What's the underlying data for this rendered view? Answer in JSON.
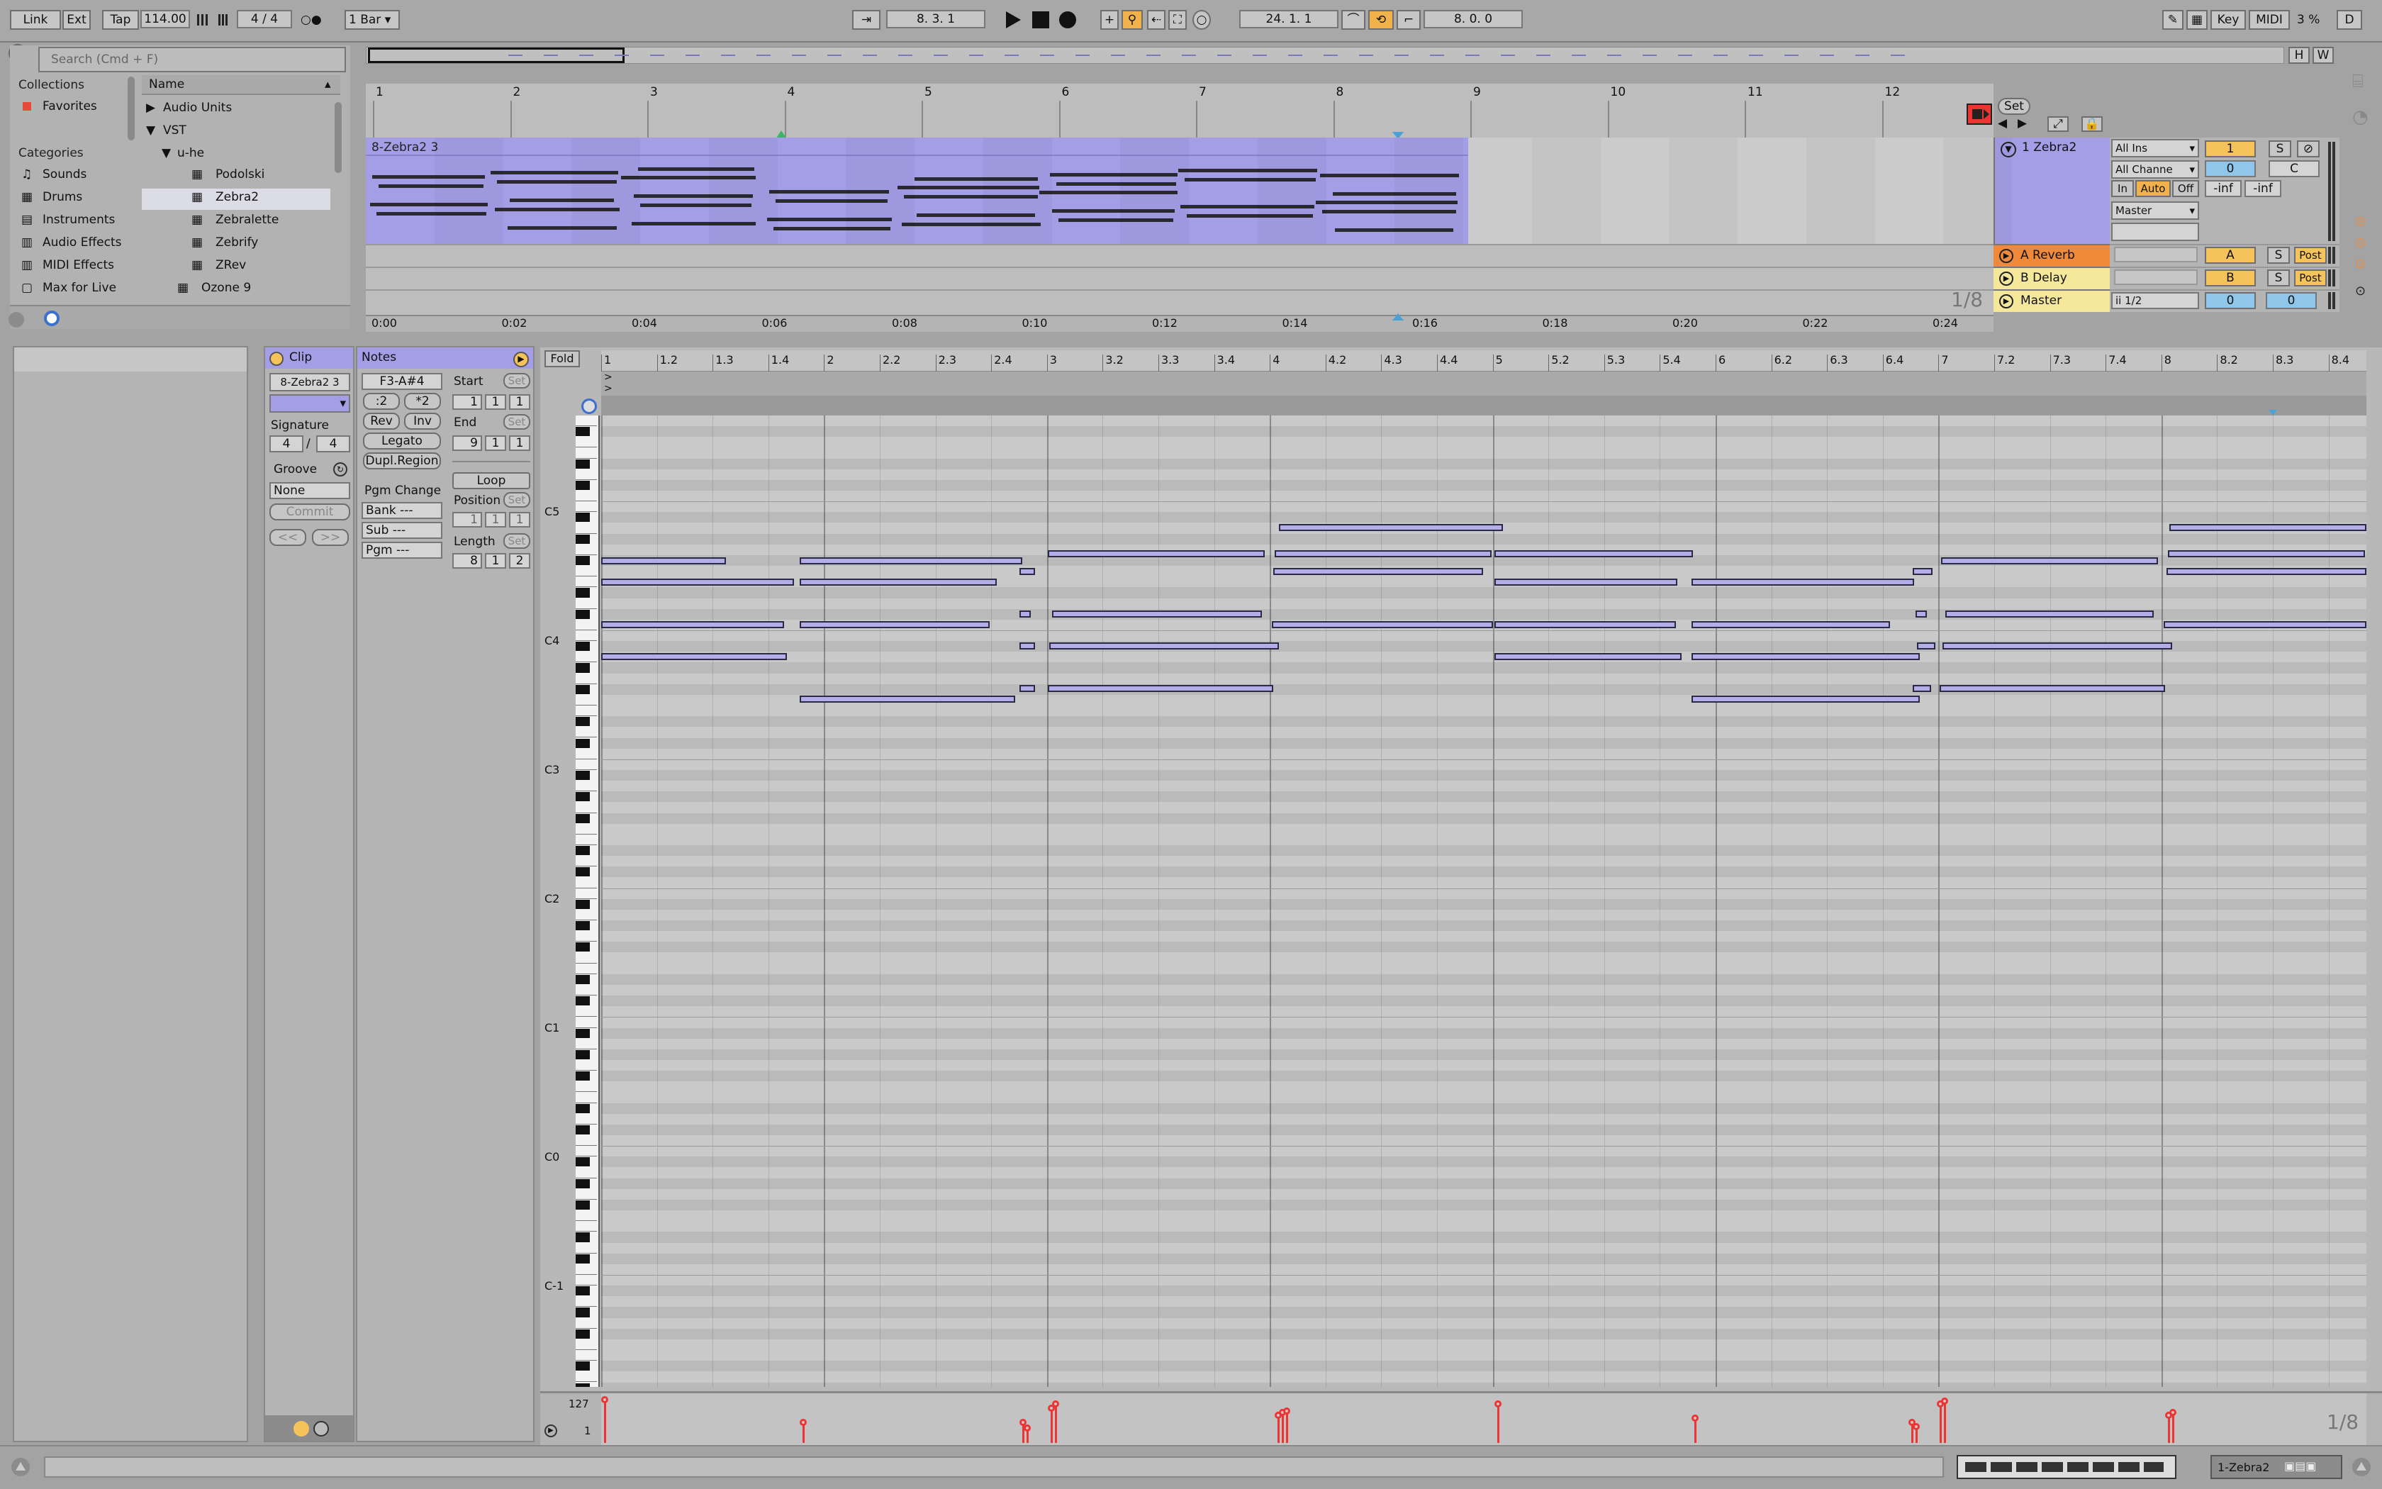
{
  "transport": {
    "link": "Link",
    "ext": "Ext",
    "tap": "Tap",
    "tempo": "114.00",
    "signature": "4 / 4",
    "metronome": "○●",
    "quantize": "1 Bar",
    "arrangement_position": "8.   3.   1",
    "loop_start": "24.   1.   1",
    "loop_length": "8.   0.   0",
    "key": "Key",
    "midi": "MIDI",
    "cpu": "3 %",
    "disk": "D"
  },
  "browser": {
    "search_placeholder": "Search (Cmd + F)",
    "collections_heading": "Collections",
    "favorites": "Favorites",
    "categories_heading": "Categories",
    "categories": [
      "Sounds",
      "Drums",
      "Instruments",
      "Audio Effects",
      "MIDI Effects",
      "Max for Live"
    ],
    "column_name": "Name",
    "tree": [
      "Audio Units",
      "VST",
      "u-he",
      "Podolski",
      "Zebra2",
      "Zebralette",
      "Zebrify",
      "ZRev",
      "Ozone 9"
    ]
  },
  "arrangement": {
    "bar_numbers": [
      "1",
      "2",
      "3",
      "4",
      "5",
      "6",
      "7",
      "8",
      "9",
      "10",
      "11",
      "12"
    ],
    "time_labels": [
      "0:00",
      "0:02",
      "0:04",
      "0:06",
      "0:08",
      "0:10",
      "0:12",
      "0:14",
      "0:16",
      "0:18",
      "0:20",
      "0:22",
      "0:24"
    ],
    "clip_name": "8-Zebra2 3",
    "grid": "1/8",
    "set_button": "Set",
    "view_h": "H",
    "view_w": "W"
  },
  "mixer": {
    "track_name": "1 Zebra2",
    "input_type": "All Ins",
    "input_channel": "All Channe",
    "monitor_in": "In",
    "monitor_auto": "Auto",
    "monitor_off": "Off",
    "output": "Master",
    "track_number": "1",
    "solo": "S",
    "volume": "0",
    "pan": "C",
    "peak_l": "-inf",
    "peak_r": "-inf",
    "returns": [
      {
        "name": "A Reverb",
        "letter": "A",
        "solo": "S",
        "post": "Post",
        "color": "#f08a3a"
      },
      {
        "name": "B Delay",
        "letter": "B",
        "solo": "S",
        "post": "Post",
        "color": "#f6e89a"
      },
      {
        "name": "Master",
        "letter": "0",
        "solo": "",
        "post": "",
        "color": "#f6e89a"
      }
    ],
    "master_cue": "ii 1/2",
    "master_vol": "0"
  },
  "clip_view": {
    "clip_title": "Clip",
    "clip_name": "8-Zebra2 3",
    "signature_label": "Signature",
    "sig_num": "4",
    "sig_den": "4",
    "groove_label": "Groove",
    "groove_value": "None",
    "commit": "Commit",
    "nav_prev": "<<",
    "nav_next": ">>",
    "notes_title": "Notes",
    "note_range": "F3-A#4",
    "half": ":2",
    "double": "*2",
    "rev": "Rev",
    "inv": "Inv",
    "legato": "Legato",
    "dupl": "Dupl.Region",
    "pgm_change": "Pgm Change",
    "bank": "Bank ---",
    "sub": "Sub ---",
    "pgm": "Pgm ---",
    "start_label": "Start",
    "start": [
      "1",
      "1",
      "1"
    ],
    "end_label": "End",
    "end": [
      "9",
      "1",
      "1"
    ],
    "loop": "Loop",
    "position_label": "Position",
    "position": [
      "1",
      "1",
      "1"
    ],
    "length_label": "Length",
    "length": [
      "8",
      "1",
      "2"
    ],
    "set": "Set"
  },
  "piano_roll": {
    "fold": "Fold",
    "beat_labels": [
      "1",
      "1.2",
      "1.3",
      "1.4",
      "2",
      "2.2",
      "2.3",
      "2.4",
      "3",
      "3.2",
      "3.3",
      "3.4",
      "4",
      "4.2",
      "4.3",
      "4.4",
      "5",
      "5.2",
      "5.3",
      "5.4",
      "6",
      "6.2",
      "6.3",
      "6.4",
      "7",
      "7.2",
      "7.3",
      "7.4",
      "8",
      "8.2",
      "8.3",
      "8.4"
    ],
    "octave_labels": [
      "C5",
      "C4",
      "C3",
      "C2",
      "C1",
      "C0",
      "C-1"
    ],
    "vel_max": "127",
    "vel_min": "1",
    "grid": "1/8"
  },
  "status_bar": {
    "track_label": "1-Zebra2"
  }
}
